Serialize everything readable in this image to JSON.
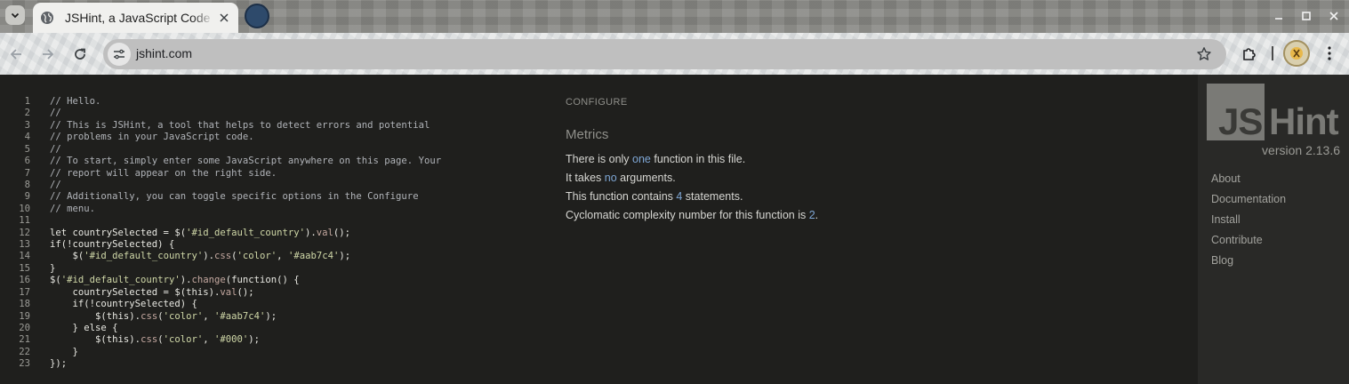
{
  "browser": {
    "tab": {
      "title": "JSHint, a JavaScript Code Quality Tool"
    },
    "omnibox": {
      "url": "jshint.com"
    }
  },
  "editor": {
    "lines": [
      {
        "n": "1",
        "tokens": [
          {
            "t": "// Hello.",
            "c": "c-comment"
          }
        ]
      },
      {
        "n": "2",
        "tokens": [
          {
            "t": "//",
            "c": "c-comment"
          }
        ]
      },
      {
        "n": "3",
        "tokens": [
          {
            "t": "// This is JSHint, a tool that helps to detect errors and potential",
            "c": "c-comment"
          }
        ]
      },
      {
        "n": "4",
        "tokens": [
          {
            "t": "// problems in your JavaScript code.",
            "c": "c-comment"
          }
        ]
      },
      {
        "n": "5",
        "tokens": [
          {
            "t": "//",
            "c": "c-comment"
          }
        ]
      },
      {
        "n": "6",
        "tokens": [
          {
            "t": "// To start, simply enter some JavaScript anywhere on this page. Your",
            "c": "c-comment"
          }
        ]
      },
      {
        "n": "7",
        "tokens": [
          {
            "t": "// report will appear on the right side.",
            "c": "c-comment"
          }
        ]
      },
      {
        "n": "8",
        "tokens": [
          {
            "t": "//",
            "c": "c-comment"
          }
        ]
      },
      {
        "n": "9",
        "tokens": [
          {
            "t": "// Additionally, you can toggle specific options in the Configure",
            "c": "c-comment"
          }
        ]
      },
      {
        "n": "10",
        "tokens": [
          {
            "t": "// menu.",
            "c": "c-comment"
          }
        ]
      },
      {
        "n": "11",
        "tokens": []
      },
      {
        "n": "12",
        "tokens": [
          {
            "t": "let countrySelected = $(",
            "c": "c-kw"
          },
          {
            "t": "'#id_default_country'",
            "c": "c-str"
          },
          {
            "t": ").",
            "c": "c-kw"
          },
          {
            "t": "val",
            "c": "c-fn"
          },
          {
            "t": "();",
            "c": "c-kw"
          }
        ]
      },
      {
        "n": "13",
        "tokens": [
          {
            "t": "if(!countrySelected) {",
            "c": "c-kw"
          }
        ]
      },
      {
        "n": "14",
        "tokens": [
          {
            "t": "    $(",
            "c": "c-kw"
          },
          {
            "t": "'#id_default_country'",
            "c": "c-str"
          },
          {
            "t": ").",
            "c": "c-kw"
          },
          {
            "t": "css",
            "c": "c-fn"
          },
          {
            "t": "(",
            "c": "c-kw"
          },
          {
            "t": "'color'",
            "c": "c-str"
          },
          {
            "t": ", ",
            "c": "c-kw"
          },
          {
            "t": "'#aab7c4'",
            "c": "c-str"
          },
          {
            "t": ");",
            "c": "c-kw"
          }
        ]
      },
      {
        "n": "15",
        "tokens": [
          {
            "t": "}",
            "c": "c-kw"
          }
        ]
      },
      {
        "n": "16",
        "tokens": [
          {
            "t": "$(",
            "c": "c-kw"
          },
          {
            "t": "'#id_default_country'",
            "c": "c-str"
          },
          {
            "t": ").",
            "c": "c-kw"
          },
          {
            "t": "change",
            "c": "c-fn"
          },
          {
            "t": "(function() {",
            "c": "c-kw"
          }
        ]
      },
      {
        "n": "17",
        "tokens": [
          {
            "t": "    countrySelected = $(this).",
            "c": "c-kw"
          },
          {
            "t": "val",
            "c": "c-fn"
          },
          {
            "t": "();",
            "c": "c-kw"
          }
        ]
      },
      {
        "n": "18",
        "tokens": [
          {
            "t": "    if(!countrySelected) {",
            "c": "c-kw"
          }
        ]
      },
      {
        "n": "19",
        "tokens": [
          {
            "t": "        $(this).",
            "c": "c-kw"
          },
          {
            "t": "css",
            "c": "c-fn"
          },
          {
            "t": "(",
            "c": "c-kw"
          },
          {
            "t": "'color'",
            "c": "c-str"
          },
          {
            "t": ", ",
            "c": "c-kw"
          },
          {
            "t": "'#aab7c4'",
            "c": "c-str"
          },
          {
            "t": ");",
            "c": "c-kw"
          }
        ]
      },
      {
        "n": "20",
        "tokens": [
          {
            "t": "    } else {",
            "c": "c-kw"
          }
        ]
      },
      {
        "n": "21",
        "tokens": [
          {
            "t": "        $(this).",
            "c": "c-kw"
          },
          {
            "t": "css",
            "c": "c-fn"
          },
          {
            "t": "(",
            "c": "c-kw"
          },
          {
            "t": "'color'",
            "c": "c-str"
          },
          {
            "t": ", ",
            "c": "c-kw"
          },
          {
            "t": "'#000'",
            "c": "c-str"
          },
          {
            "t": ");",
            "c": "c-kw"
          }
        ]
      },
      {
        "n": "22",
        "tokens": [
          {
            "t": "    }",
            "c": "c-kw"
          }
        ]
      },
      {
        "n": "23",
        "tokens": [
          {
            "t": "});",
            "c": "c-kw"
          }
        ]
      }
    ]
  },
  "report": {
    "configure_label": "Configure",
    "metrics_title": "Metrics",
    "line1": {
      "pre": "There is only ",
      "hl": "one",
      "post": " function in this file."
    },
    "line2": {
      "pre": "It takes ",
      "hl": "no",
      "post": " arguments."
    },
    "line3": {
      "pre": "This function contains ",
      "hl": "4",
      "post": " statements."
    },
    "line4": {
      "pre": "Cyclomatic complexity number for this function is ",
      "hl": "2",
      "post": "."
    }
  },
  "sidebar": {
    "logo_js": "JS",
    "logo_hint": "Hint",
    "version": "version 2.13.6",
    "links": [
      "About",
      "Documentation",
      "Install",
      "Contribute",
      "Blog"
    ]
  },
  "colors": {
    "page_bg": "#1f1f1d",
    "sidebar_bg": "#292927",
    "metric_highlight": "#7ea6d4"
  }
}
